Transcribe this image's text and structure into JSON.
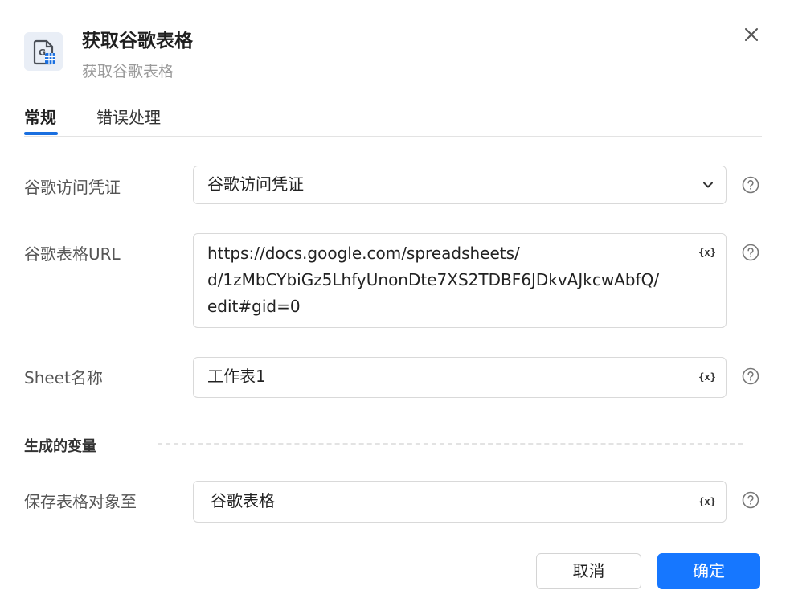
{
  "header": {
    "title": "获取谷歌表格",
    "subtitle": "获取谷歌表格"
  },
  "tabs": [
    {
      "label": "常规",
      "active": true
    },
    {
      "label": "错误处理",
      "active": false
    }
  ],
  "fields": {
    "credential": {
      "label": "谷歌访问凭证",
      "value": "谷歌访问凭证"
    },
    "url": {
      "label": "谷歌表格URL",
      "value_lines": [
        "https://docs.google.com/spreadsheets/",
        "d/1zMbCYbiGz5LhfyUnonDte7XS2TDBF6JDkvAJkcwAbfQ/",
        "edit#gid=0"
      ]
    },
    "sheet_name": {
      "label": "Sheet名称",
      "value": "工作表1"
    }
  },
  "variables_section": {
    "title": "生成的变量",
    "save_to": {
      "label": "保存表格对象至",
      "value": "谷歌表格"
    }
  },
  "variable_icon_text": "{x}",
  "buttons": {
    "cancel": "取消",
    "ok": "确定"
  },
  "colors": {
    "accent": "#1677ff",
    "tab_underline": "#1a6fe0"
  }
}
